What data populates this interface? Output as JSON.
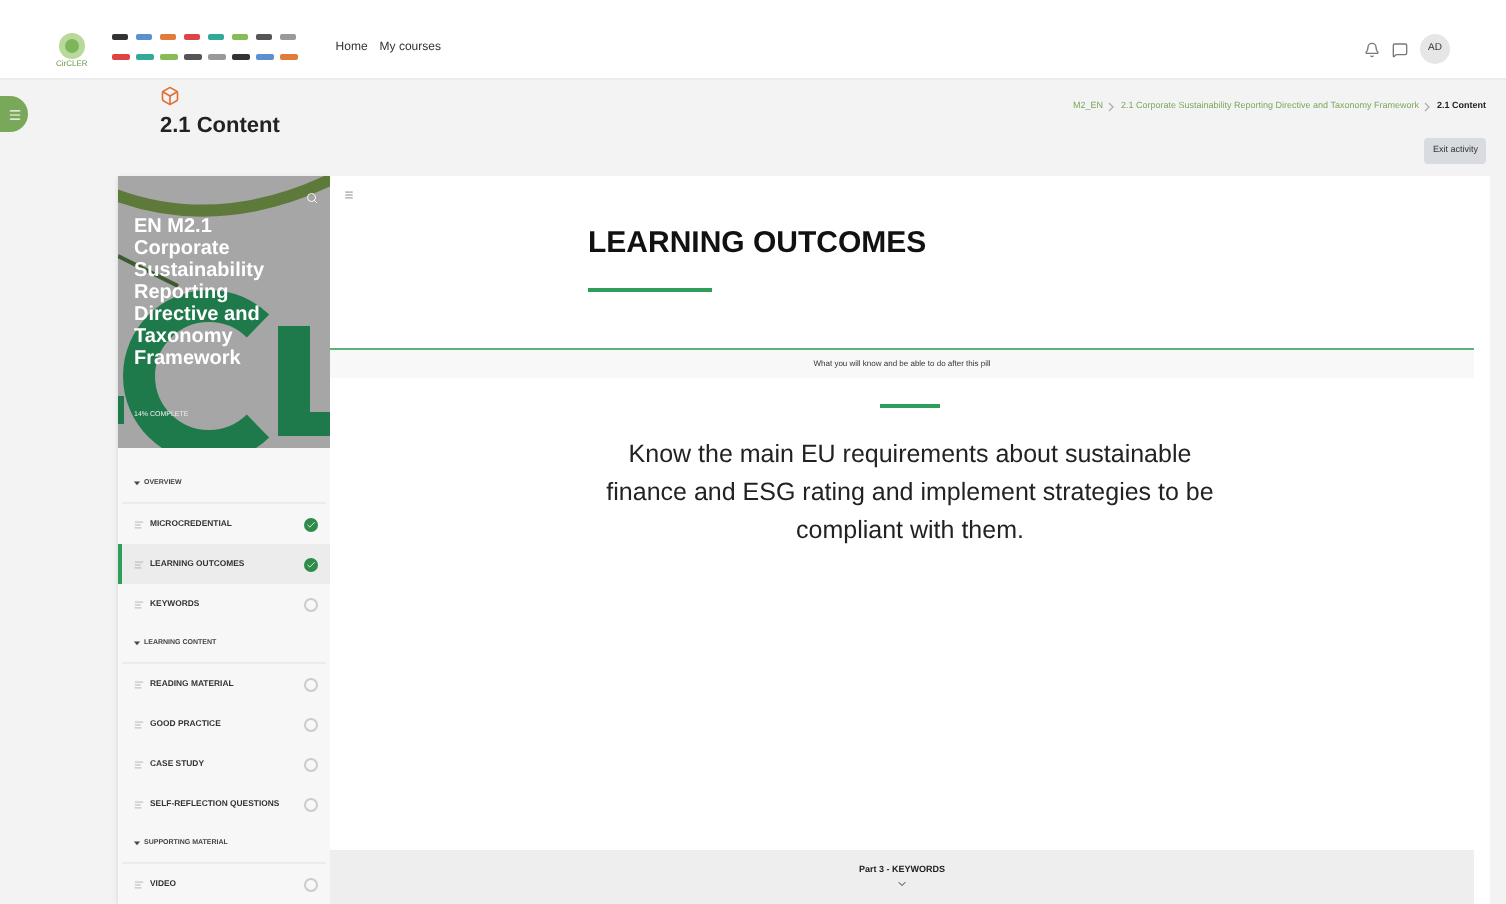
{
  "navbar": {
    "brand": "CirCLER",
    "links": [
      "Home",
      "My courses"
    ],
    "avatar": "AD"
  },
  "header": {
    "title": "2.1 Content",
    "breadcrumbs": [
      {
        "label": "M2_EN",
        "current": false
      },
      {
        "label": "2.1 Corporate Sustainability Reporting Directive and Taxonomy Framework",
        "current": false
      },
      {
        "label": "2.1 Content",
        "current": true
      }
    ],
    "exit_button": "Exit activity"
  },
  "course_index": {
    "title": "EN M2.1 Corporate Sustainability Reporting Directive and Taxonomy Framework",
    "progress": "14% COMPLETE",
    "items": [
      {
        "kind": "section",
        "label": "OVERVIEW"
      },
      {
        "kind": "lesson",
        "label": "MICROCREDENTIAL",
        "checked": true,
        "selected": false
      },
      {
        "kind": "lesson",
        "label": "LEARNING OUTCOMES",
        "checked": true,
        "selected": true
      },
      {
        "kind": "lesson",
        "label": "KEYWORDS",
        "checked": false,
        "selected": false
      },
      {
        "kind": "section",
        "label": "LEARNING CONTENT"
      },
      {
        "kind": "lesson",
        "label": "READING MATERIAL",
        "checked": false,
        "selected": false
      },
      {
        "kind": "lesson",
        "label": "GOOD PRACTICE",
        "checked": false,
        "selected": false
      },
      {
        "kind": "lesson",
        "label": "CASE STUDY",
        "checked": false,
        "selected": false
      },
      {
        "kind": "lesson",
        "label": "SELF-REFLECTION QUESTIONS",
        "checked": false,
        "selected": false
      },
      {
        "kind": "section",
        "label": "SUPPORTING MATERIAL"
      },
      {
        "kind": "lesson",
        "label": "VIDEO",
        "checked": false,
        "selected": false
      }
    ]
  },
  "lesson": {
    "title": "LEARNING OUTCOMES",
    "subtitle": "What you will know and be able to do after this pill",
    "body": "Know the main EU requirements about sustainable finance and ESG rating and implement strategies to be compliant with them.",
    "next_part": "Part 3 - KEYWORDS"
  }
}
